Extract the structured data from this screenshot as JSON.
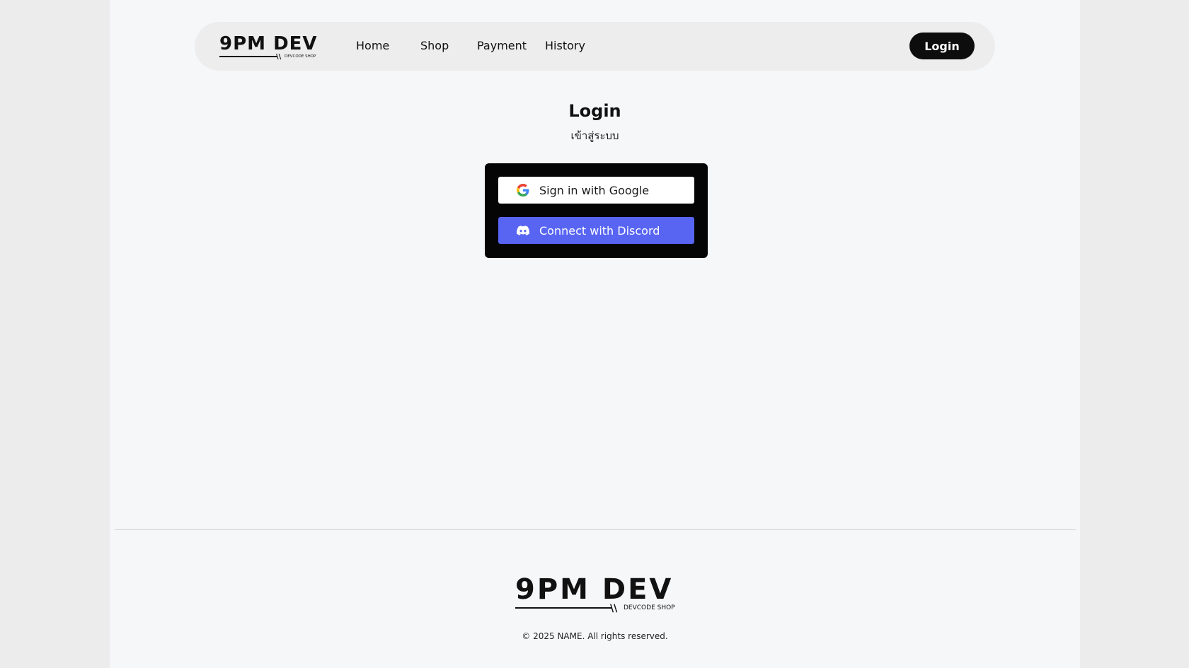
{
  "brand": {
    "name": "9PM DEV",
    "tagline": "DEVCODE SHOP"
  },
  "nav": {
    "links": [
      "Home",
      "Shop",
      "Payment",
      "History"
    ],
    "login_label": "Login"
  },
  "main": {
    "title": "Login",
    "subtitle": "เข้าสู่ระบบ",
    "google_button": "Sign in with Google",
    "discord_button": "Connect with Discord",
    "google_icon": "google-icon",
    "discord_icon": "discord-icon"
  },
  "footer": {
    "copyright": "© 2025 NAME. All rights reserved."
  },
  "colors": {
    "discord": "#5865f2",
    "card": "#050505",
    "navbar": "#ededee"
  }
}
